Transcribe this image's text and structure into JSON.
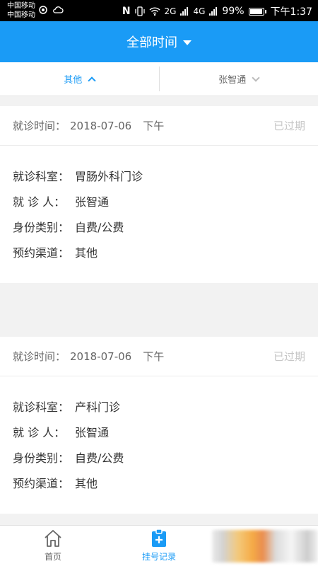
{
  "status_bar": {
    "carrier_1": "中国移动",
    "carrier_2": "中国移动",
    "nfc": "N",
    "network_2g": "2G",
    "network_4g": "4G",
    "battery_percent": "99%",
    "time": "下午1:37"
  },
  "header": {
    "title": "全部时间"
  },
  "filters": [
    {
      "label": "其他",
      "state": "active"
    },
    {
      "label": "张智通",
      "state": "inactive"
    }
  ],
  "records": [
    {
      "visit_time_label": "就诊时间：",
      "visit_date": "2018-07-06",
      "visit_period": "下午",
      "status": "已过期",
      "fields": [
        {
          "key": "就诊科室：",
          "value": "胃肠外科门诊"
        },
        {
          "key": "就 诊 人：",
          "value": "张智通"
        },
        {
          "key": "身份类别：",
          "value": "自费/公费"
        },
        {
          "key": "预约渠道：",
          "value": "其他"
        }
      ]
    },
    {
      "visit_time_label": "就诊时间：",
      "visit_date": "2018-07-06",
      "visit_period": "下午",
      "status": "已过期",
      "fields": [
        {
          "key": "就诊科室：",
          "value": "产科门诊"
        },
        {
          "key": "就 诊 人：",
          "value": "张智通"
        },
        {
          "key": "身份类别：",
          "value": "自费/公费"
        },
        {
          "key": "预约渠道：",
          "value": "其他"
        }
      ]
    }
  ],
  "bottom_nav": [
    {
      "label": "首页",
      "icon": "home-icon",
      "active": false
    },
    {
      "label": "挂号记录",
      "icon": "clipboard-plus-icon",
      "active": true
    }
  ],
  "colors": {
    "primary": "#1a9bf6",
    "muted": "#c7c7c7"
  }
}
